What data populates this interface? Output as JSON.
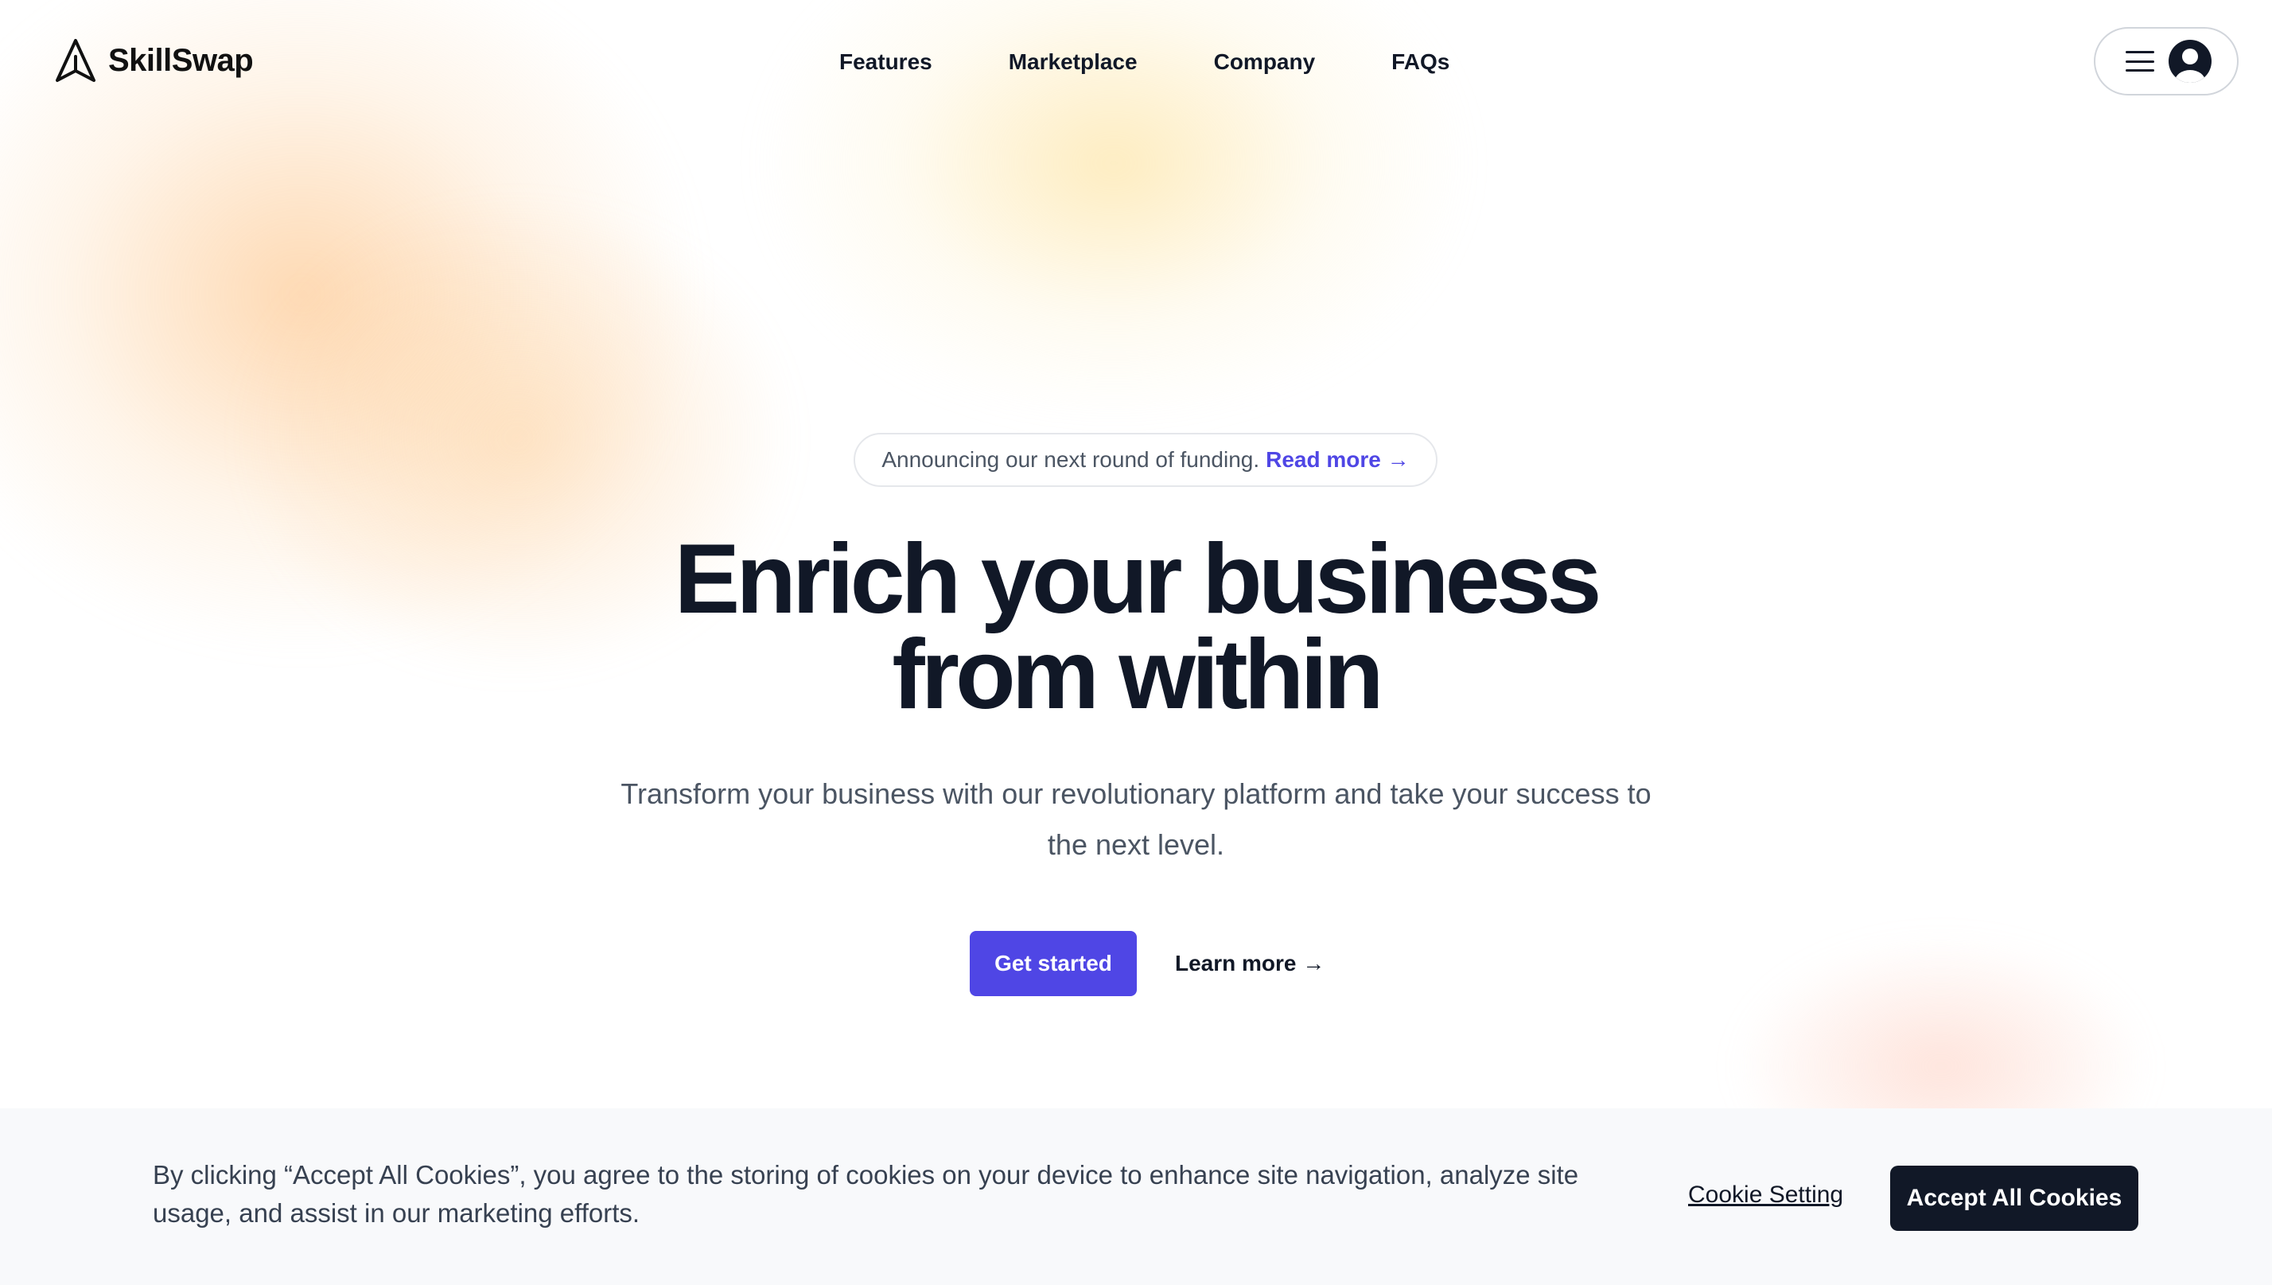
{
  "brand": {
    "name": "SkillSwap",
    "logo_icon": "paper-plane-icon"
  },
  "nav": {
    "items": [
      {
        "label": "Features"
      },
      {
        "label": "Marketplace"
      },
      {
        "label": "Company"
      },
      {
        "label": "FAQs"
      }
    ]
  },
  "user_menu": {
    "menu_icon": "hamburger-icon",
    "avatar_icon": "user-avatar-icon"
  },
  "announcement": {
    "text": "Announcing our next round of funding.",
    "link_label": "Read more →"
  },
  "hero": {
    "title_line1": "Enrich your business",
    "title_line2": "from within",
    "subtitle": "Transform your business with our revolutionary platform and take your success to the next level.",
    "primary_cta": "Get started",
    "secondary_cta": "Learn more →"
  },
  "cookie_banner": {
    "message": "By clicking “Accept All Cookies”, you agree to the storing of cookies on your device to enhance site navigation, analyze site usage, and assist in our marketing efforts.",
    "settings_label": "Cookie Setting",
    "accept_label": "Accept All Cookies"
  },
  "colors": {
    "accent": "#4f46e5",
    "dark": "#111827",
    "banner_bg": "#f8f9fb"
  }
}
